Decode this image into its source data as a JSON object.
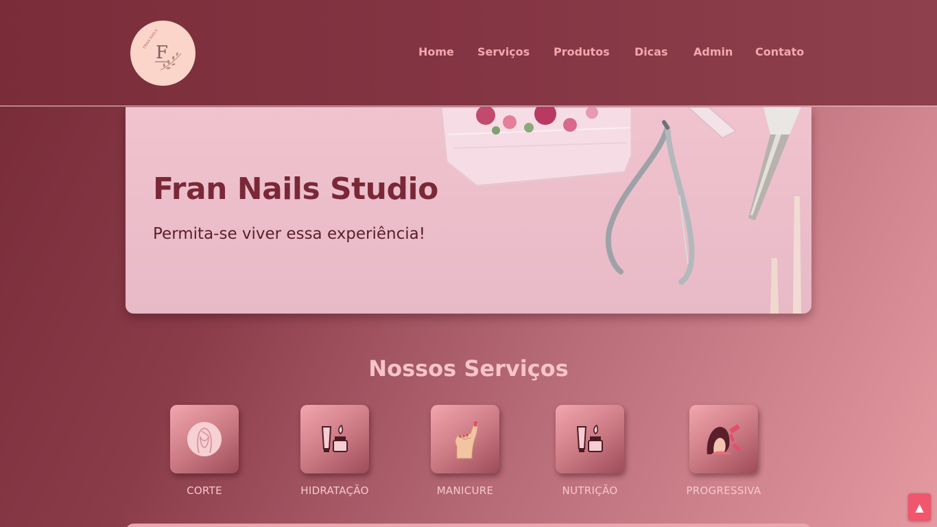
{
  "brand": {
    "logo_letter": "F",
    "logo_caption": "FRAN NAILS"
  },
  "nav": {
    "items": [
      {
        "label": "Home"
      },
      {
        "label": "Serviços"
      },
      {
        "label": "Produtos"
      },
      {
        "label": "Dicas"
      },
      {
        "label": "Admin"
      },
      {
        "label": "Contato"
      }
    ]
  },
  "hero": {
    "title": "Fran Nails Studio",
    "subtitle": "Permita-se viver essa experiência!"
  },
  "services": {
    "title": "Nossos Serviços",
    "items": [
      {
        "label": "CORTE",
        "icon": "woman-face-icon"
      },
      {
        "label": "HIDRATAÇÃO",
        "icon": "cosmetics-icon"
      },
      {
        "label": "MANICURE",
        "icon": "nail-hand-icon"
      },
      {
        "label": "NUTRIÇÃO",
        "icon": "cosmetics-icon"
      },
      {
        "label": "PROGRESSIVA",
        "icon": "hair-dryer-icon"
      }
    ]
  },
  "scroll_top": {
    "icon": "arrow-up-icon",
    "glyph": "▲"
  },
  "colors": {
    "header": "#843543",
    "accent_nav": "#f1a9ad",
    "hero_title": "#7a2838",
    "logo_bg": "#fbd5c9",
    "scroll_button": "#f0566c"
  }
}
